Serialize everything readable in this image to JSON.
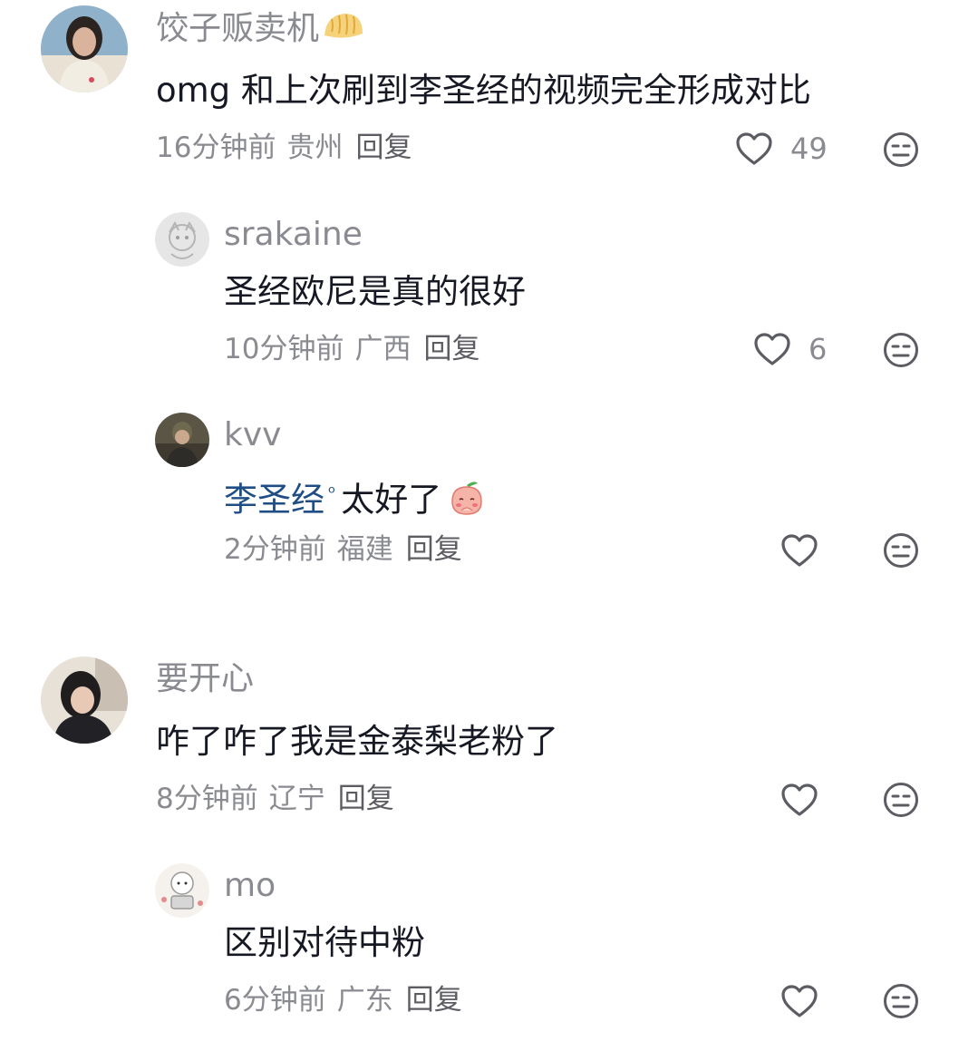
{
  "comments": [
    {
      "username": "饺子贩卖机",
      "username_emoji": "dumpling-icon",
      "text": "omg 和上次刷到李圣经的视频完全形成对比",
      "time": "16分钟前",
      "location": "贵州",
      "reply_label": "回复",
      "likes": "49",
      "replies": [
        {
          "username": "srakaine",
          "text": "圣经欧尼是真的很好",
          "time": "10分钟前",
          "location": "广西",
          "reply_label": "回复",
          "likes": "6"
        },
        {
          "username": "kvv",
          "mention": "李圣经",
          "mention_mark": "ᵒ",
          "text": "太好了",
          "text_emoji": "shy-peach-emoji",
          "time": "2分钟前",
          "location": "福建",
          "reply_label": "回复",
          "likes": ""
        }
      ]
    },
    {
      "username": "要开心",
      "text": "咋了咋了我是金泰梨老粉了",
      "time": "8分钟前",
      "location": "辽宁",
      "reply_label": "回复",
      "likes": "",
      "replies": [
        {
          "username": "mo",
          "text": "区别对待中粉",
          "time": "6分钟前",
          "location": "广东",
          "reply_label": "回复",
          "likes": ""
        }
      ]
    }
  ],
  "icons": {
    "like": "heart-outline-icon",
    "dislike": "neutral-face-icon"
  },
  "colors": {
    "text": "#161823",
    "secondary": "#8a8b91",
    "mention": "#1f4e86"
  }
}
